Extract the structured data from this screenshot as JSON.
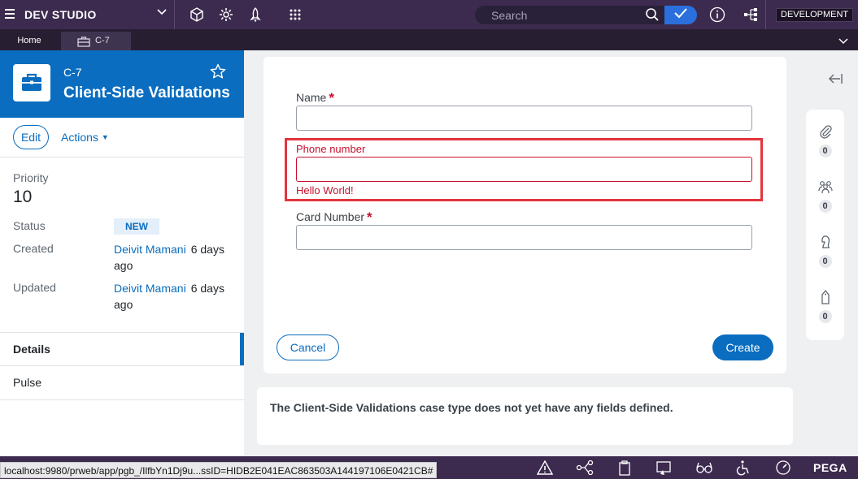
{
  "topbar": {
    "studio_label": "DEV STUDIO",
    "search_placeholder": "Search",
    "environment_badge": "DEVELOPMENT",
    "background": "#3d2b4f"
  },
  "tabs": [
    {
      "label": "Home"
    },
    {
      "label": "C-7",
      "icon": "briefcase-icon"
    }
  ],
  "case": {
    "id": "C-7",
    "title": "Client-Side Validations",
    "edit_label": "Edit",
    "actions_label": "Actions",
    "priority_label": "Priority",
    "priority_value": "10",
    "status_label": "Status",
    "status_value": "NEW",
    "created_label": "Created",
    "created_by": "Deivit Mamani",
    "created_when": "6 days ago",
    "updated_label": "Updated",
    "updated_by": "Deivit Mamani",
    "updated_when": "6 days ago",
    "nav": [
      {
        "label": "Details",
        "active": true
      },
      {
        "label": "Pulse",
        "active": false
      }
    ],
    "accent": "#0a6dbf"
  },
  "form": {
    "name_label": "Name",
    "name_required": "*",
    "name_value": "",
    "phone_label": "Phone number",
    "phone_value": "",
    "phone_error": "Hello World!",
    "card_label": "Card Number",
    "card_required": "*",
    "card_value": "",
    "cancel_label": "Cancel",
    "create_label": "Create",
    "error_color": "#c8102e"
  },
  "info": {
    "message": "The Client-Side Validations case type does not yet have any fields defined."
  },
  "utility": [
    {
      "icon": "paperclip-icon",
      "count": "0"
    },
    {
      "icon": "followers-icon",
      "count": "0"
    },
    {
      "icon": "chess-knight-icon",
      "count": "0"
    },
    {
      "icon": "tag-icon",
      "count": "0"
    }
  ],
  "status_bar": {
    "url": "localhost:9980/prweb/app/pgb_/IlfbYn1Dj9u...ssID=HIDB2E041EAC863503A144197106E0421CB#",
    "brand": "PEGA"
  }
}
